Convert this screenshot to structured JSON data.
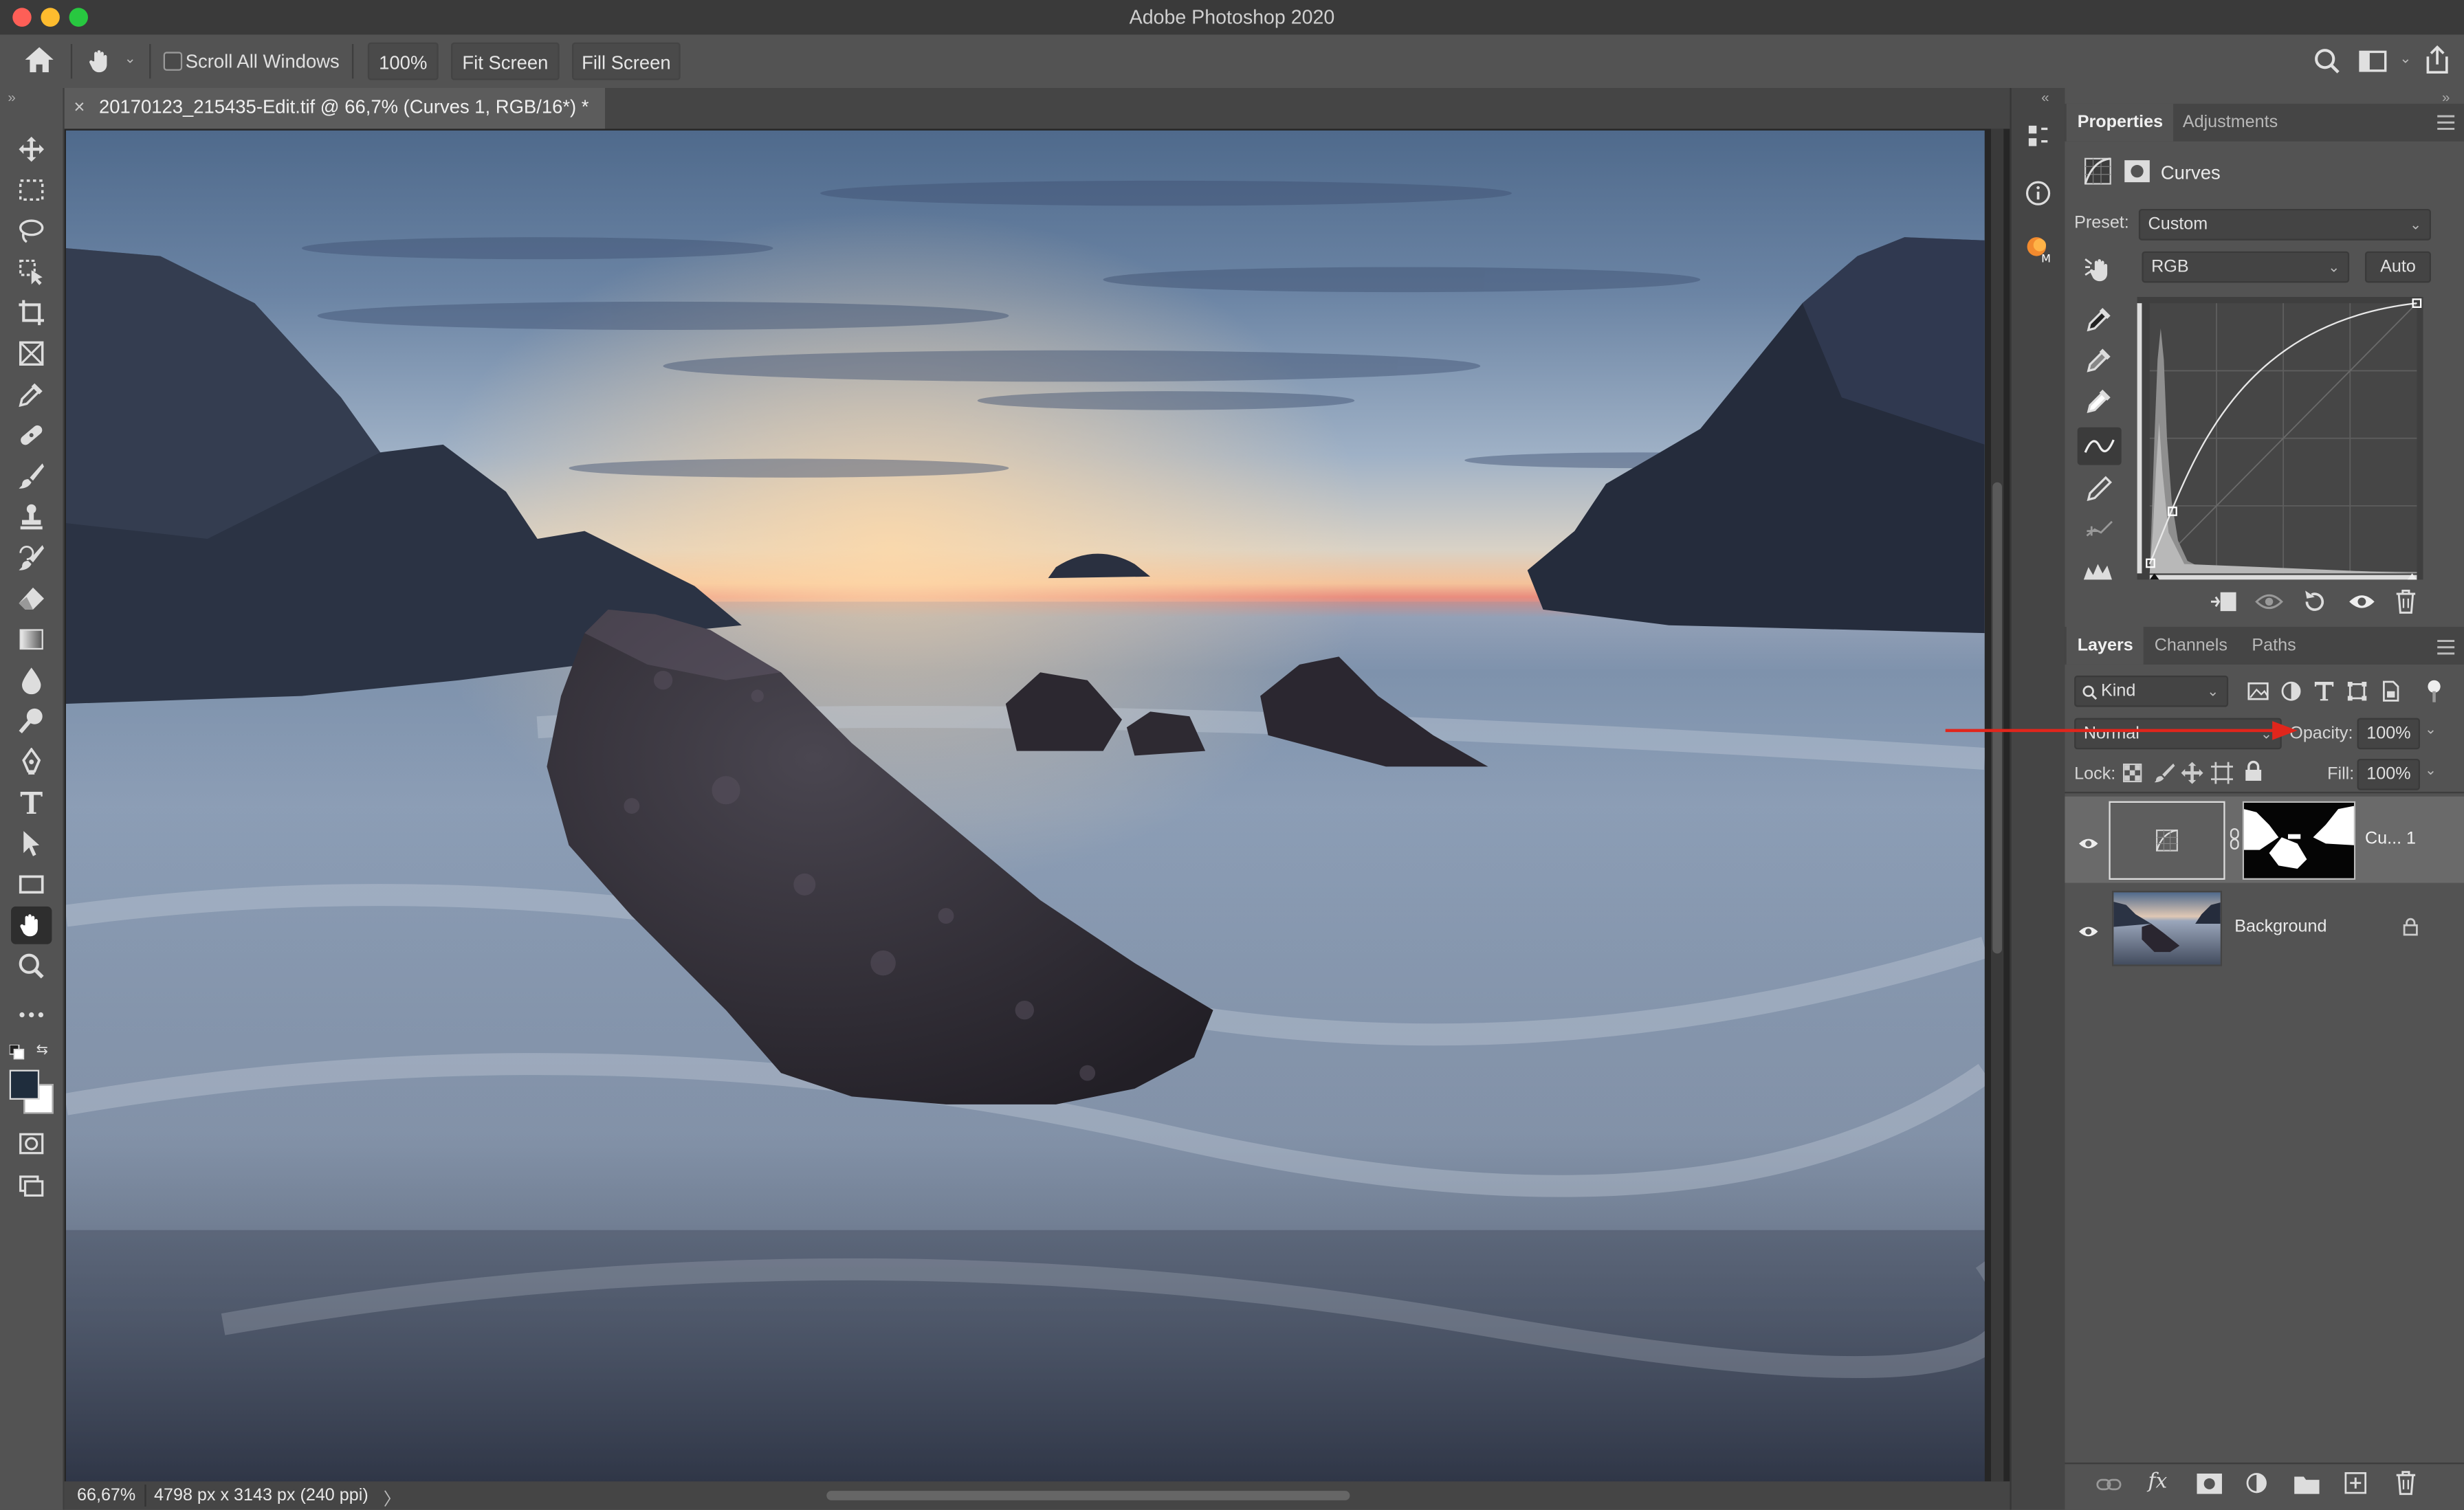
{
  "window": {
    "title": "Adobe Photoshop 2020",
    "traffic_colors": [
      "#fe5f57",
      "#febc2e",
      "#28c840"
    ]
  },
  "options_bar": {
    "scroll_all_windows_label": "Scroll All Windows",
    "scroll_all_windows_checked": false,
    "zoom_button": "100%",
    "fit_screen_button": "Fit Screen",
    "fill_screen_button": "Fill Screen"
  },
  "document": {
    "tab_title": "20170123_215435-Edit.tif @ 66,7% (Curves 1, RGB/16*) *",
    "close_glyph": "×"
  },
  "status_bar": {
    "zoom": "66,67%",
    "info": "4798 px x 3143 px (240 ppi)",
    "arrow": "〉"
  },
  "properties_panel": {
    "tabs": [
      "Properties",
      "Adjustments"
    ],
    "active_tab": "Properties",
    "adjustment_name": "Curves",
    "preset_label": "Preset:",
    "preset_value": "Custom",
    "channel_value": "RGB",
    "auto_button": "Auto"
  },
  "layers_panel": {
    "tabs": [
      "Layers",
      "Channels",
      "Paths"
    ],
    "active_tab": "Layers",
    "filter_kind": "Kind",
    "blend_mode": "Normal",
    "opacity_label": "Opacity:",
    "opacity_value": "100%",
    "lock_label": "Lock:",
    "fill_label": "Fill:",
    "fill_value": "100%",
    "layers": [
      {
        "name": "Cu... 1",
        "visible": true,
        "selected": true
      },
      {
        "name": "Background",
        "visible": true,
        "locked": true
      }
    ]
  },
  "annotation": {
    "arrow_color": "#e0261c"
  }
}
